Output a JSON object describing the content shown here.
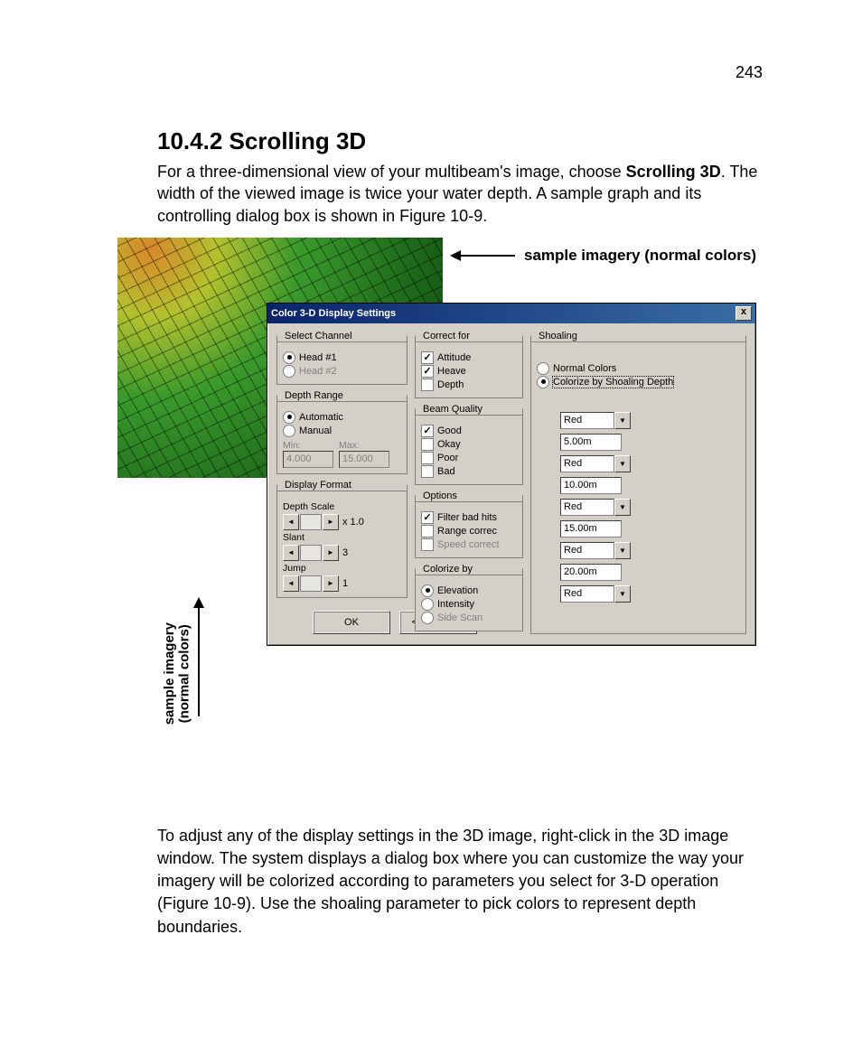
{
  "page_number": "243",
  "heading": "10.4.2    Scrolling 3D",
  "intro_pre": "For a three-dimensional view of your multibeam's image, choose ",
  "intro_bold1": "Scrolling 3D",
  "intro_post": ". The width of the viewed image is twice your water depth. A sample graph and its controlling dialog box is shown in Figure 10-9.",
  "callout_top": "sample imagery (normal colors)",
  "callout_side_line1": "sample imagery",
  "callout_side_line2": "(normal colors)",
  "dialog": {
    "title": "Color 3-D Display Settings",
    "close_glyph": "x",
    "select_channel": {
      "legend": "Select Channel",
      "head1": "Head #1",
      "head2": "Head #2"
    },
    "depth_range": {
      "legend": "Depth Range",
      "automatic": "Automatic",
      "manual": "Manual",
      "min_label": "Min:",
      "max_label": "Max:",
      "min": "4.000",
      "max": "15.000"
    },
    "display_format": {
      "legend": "Display Format",
      "depth_scale_label": "Depth Scale",
      "depth_val": "x 1.0",
      "slant_label": "Slant",
      "slant_val": "3",
      "jump_label": "Jump",
      "jump_val": "1"
    },
    "correct_for": {
      "legend": "Correct for",
      "attitude": "Attitude",
      "heave": "Heave",
      "depth": "Depth"
    },
    "beam_quality": {
      "legend": "Beam Quality",
      "good": "Good",
      "okay": "Okay",
      "poor": "Poor",
      "bad": "Bad"
    },
    "options": {
      "legend": "Options",
      "filter": "Filter bad hits",
      "range": "Range correc",
      "speed": "Speed correct"
    },
    "colorize_by": {
      "legend": "Colorize by",
      "elevation": "Elevation",
      "intensity": "Intensity",
      "sidescan": "Side Scan"
    },
    "shoaling": {
      "legend": "Shoaling",
      "normal": "Normal Colors",
      "colorize": "Colorize by Shoaling Depth",
      "rows": [
        {
          "color": "Red",
          "depth": "5.00m"
        },
        {
          "color": "Red",
          "depth": "10.00m"
        },
        {
          "color": "Red",
          "depth": "15.00m"
        },
        {
          "color": "Red",
          "depth": "20.00m"
        },
        {
          "color": "Red",
          "depth": ""
        }
      ]
    },
    "ok": "OK",
    "shoaling_btn": "<< Shoaling"
  },
  "lower_para": "To adjust any of the display settings in the 3D image, right-click in the 3D image window. The system displays a dialog box where you can customize the way your imagery will be colorized according to parameters you select for 3-D operation (Figure 10-9). Use the shoaling parameter to pick colors to represent depth boundaries."
}
